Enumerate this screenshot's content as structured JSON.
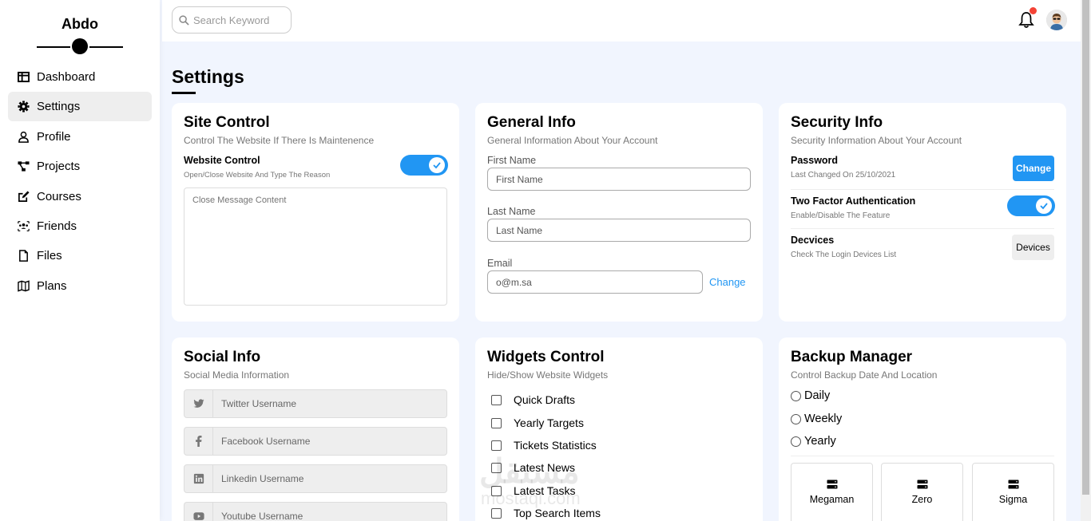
{
  "sidebar": {
    "brand": "Abdo",
    "items": [
      {
        "label": "Dashboard",
        "icon": "table-icon"
      },
      {
        "label": "Settings",
        "icon": "gear-icon",
        "active": true
      },
      {
        "label": "Profile",
        "icon": "user-icon"
      },
      {
        "label": "Projects",
        "icon": "project-diagram-icon"
      },
      {
        "label": "Courses",
        "icon": "edit-icon"
      },
      {
        "label": "Friends",
        "icon": "users-icon"
      },
      {
        "label": "Files",
        "icon": "file-icon"
      },
      {
        "label": "Plans",
        "icon": "map-icon"
      }
    ]
  },
  "header": {
    "search_placeholder": "Search Keyword",
    "notification_dot_color": "#f44336"
  },
  "page": {
    "title": "Settings"
  },
  "site_control": {
    "title": "Site Control",
    "subtitle": "Control The Website If There Is Maintenence",
    "toggle_label": "Website Control",
    "toggle_sub": "Open/Close Website And Type The Reason",
    "toggle_on": true,
    "textarea_placeholder": "Close Message Content"
  },
  "general_info": {
    "title": "General Info",
    "subtitle": "General Information About Your Account",
    "first_name_label": "First Name",
    "first_name_placeholder": "First Name",
    "last_name_label": "Last Name",
    "last_name_placeholder": "Last Name",
    "email_label": "Email",
    "email_value": "o@m.sa",
    "email_change": "Change"
  },
  "security_info": {
    "title": "Security Info",
    "subtitle": "Security Information About Your Account",
    "password_label": "Password",
    "password_sub": "Last Changed On 25/10/2021",
    "password_button": "Change",
    "twofa_label": "Two Factor Authentication",
    "twofa_sub": "Enable/Disable The Feature",
    "twofa_on": true,
    "devices_label": "Decvices",
    "devices_sub": "Check The Login Devices List",
    "devices_button": "Devices"
  },
  "social_info": {
    "title": "Social Info",
    "subtitle": "Social Media Information",
    "fields": [
      {
        "icon": "twitter-icon",
        "placeholder": "Twitter Username"
      },
      {
        "icon": "facebook-icon",
        "placeholder": "Facebook Username"
      },
      {
        "icon": "linkedin-icon",
        "placeholder": "Linkedin Username"
      },
      {
        "icon": "youtube-icon",
        "placeholder": "Youtube Username"
      }
    ]
  },
  "widgets_control": {
    "title": "Widgets Control",
    "subtitle": "Hide/Show Website Widgets",
    "items": [
      "Quick Drafts",
      "Yearly Targets",
      "Tickets Statistics",
      "Latest News",
      "Latest Tasks",
      "Top Search Items"
    ]
  },
  "backup_manager": {
    "title": "Backup Manager",
    "subtitle": "Control Backup Date And Location",
    "options": [
      "Daily",
      "Weekly",
      "Yearly"
    ],
    "servers": [
      "Megaman",
      "Zero",
      "Sigma"
    ]
  },
  "watermark": {
    "text": "مستقل",
    "sub": "mostaql.com"
  },
  "colors": {
    "accent": "#2196f3",
    "background": "#f1f5fe",
    "card": "#ffffff"
  }
}
